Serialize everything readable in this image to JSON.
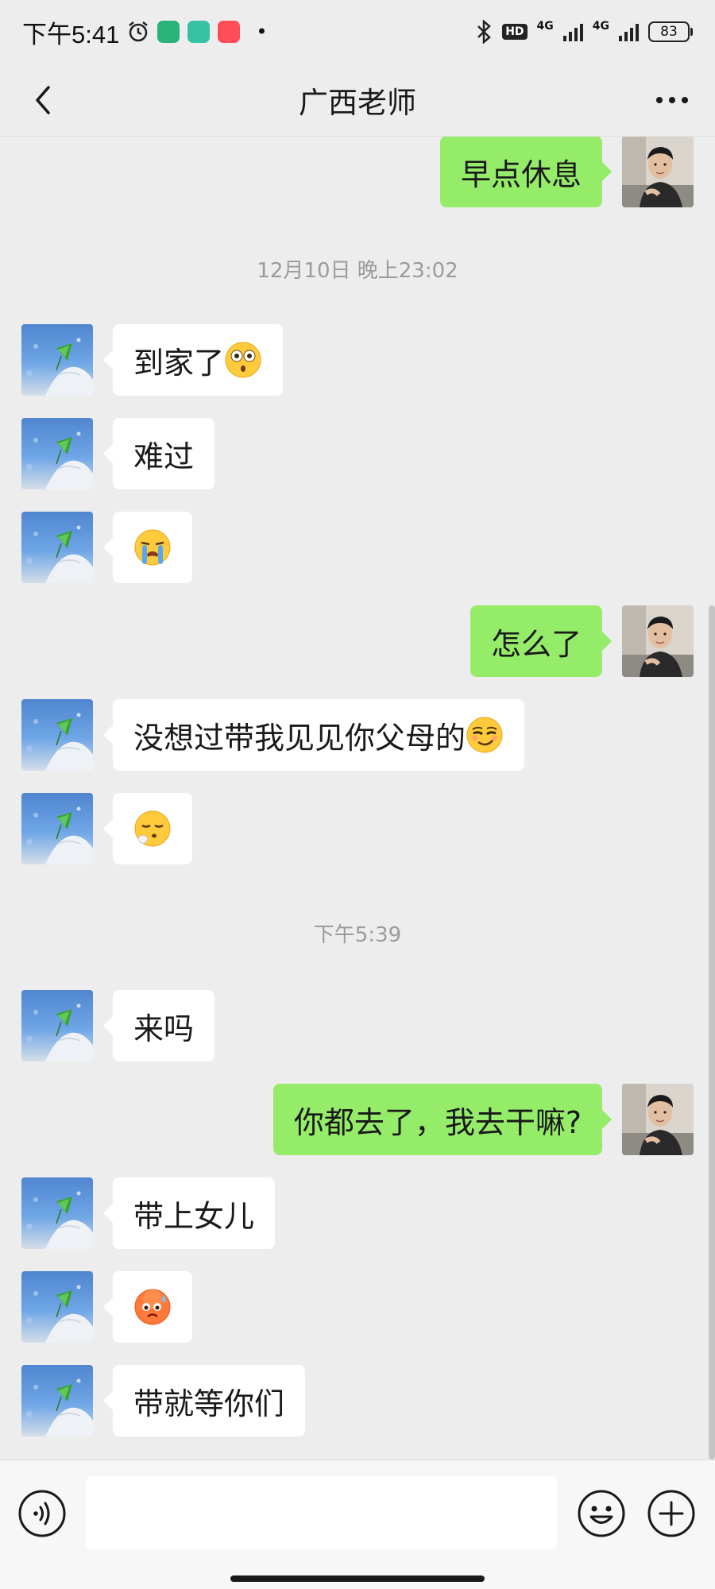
{
  "status_bar": {
    "time": "下午5:41",
    "hd_label": "HD",
    "network_1": "4G",
    "network_2": "4G",
    "battery": "83",
    "app_colors": [
      "#2ab27b",
      "#36c2a3",
      "#ff4d5a"
    ]
  },
  "nav": {
    "title": "广西老师",
    "back_icon": "chevron-left-icon",
    "more_icon": "more-dots-icon"
  },
  "chat": {
    "timestamps": [
      "12月10日 晚上23:02",
      "下午5:39"
    ],
    "messages": [
      {
        "side": "out",
        "text": "早点休息"
      },
      {
        "side": "in",
        "text": "到家了",
        "emoji": "flushed-face-emoji"
      },
      {
        "side": "in",
        "text": "难过"
      },
      {
        "side": "in",
        "text": "",
        "emoji": "crying-face-emoji"
      },
      {
        "side": "out",
        "text": "怎么了"
      },
      {
        "side": "in",
        "text": "没想过带我见见你父母的",
        "emoji": "smirk-face-emoji"
      },
      {
        "side": "in",
        "text": "",
        "emoji": "sigh-face-emoji"
      },
      {
        "side": "in",
        "text": "来吗"
      },
      {
        "side": "out",
        "text": "你都去了，我去干嘛?"
      },
      {
        "side": "in",
        "text": "带上女儿"
      },
      {
        "side": "in",
        "text": "",
        "emoji": "sweat-face-emoji"
      },
      {
        "side": "in",
        "text": "带就等你们"
      }
    ]
  },
  "input_bar": {
    "placeholder": "",
    "voice_icon": "voice-icon",
    "emoji_icon": "emoji-icon",
    "plus_icon": "plus-icon"
  },
  "colors": {
    "background": "#ededed",
    "outgoing_bubble": "#95ec69",
    "incoming_bubble": "#ffffff",
    "timestamp_text": "#9b9b9b"
  }
}
